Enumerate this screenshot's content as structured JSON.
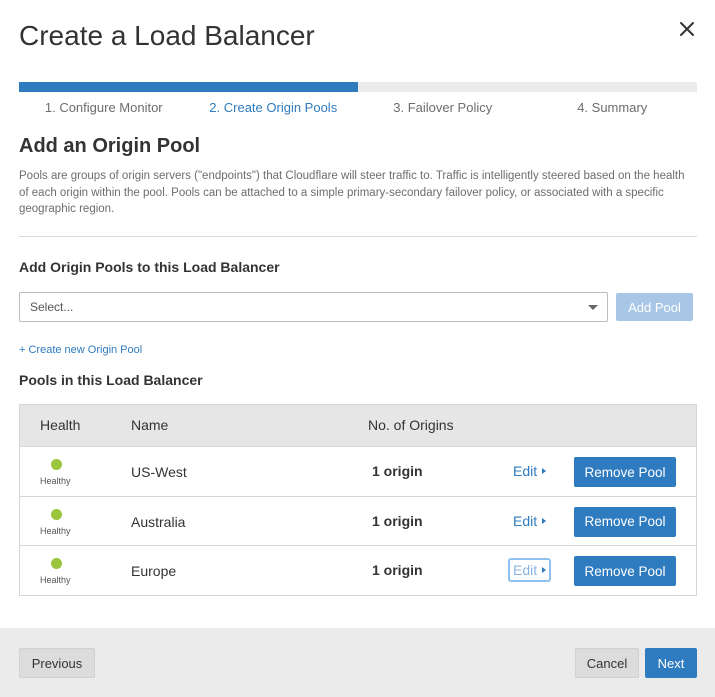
{
  "modal": {
    "title": "Create a Load Balancer"
  },
  "wizard": {
    "progress_fraction": 0.5,
    "steps": [
      {
        "label": "1. Configure Monitor"
      },
      {
        "label": "2. Create Origin Pools"
      },
      {
        "label": "3. Failover Policy"
      },
      {
        "label": "4. Summary"
      }
    ],
    "active_step": 2
  },
  "section": {
    "title": "Add an Origin Pool",
    "description": "Pools are groups of origin servers (\"endpoints\") that Cloudflare will steer traffic to. Traffic is intelligently steered based on the health of each origin within the pool. Pools can be attached to a simple primary-secondary failover policy, or associated with a specific geographic region."
  },
  "add_pools": {
    "heading": "Add Origin Pools to this Load Balancer",
    "select_value": "Select...",
    "add_button": "Add Pool",
    "create_link": "+ Create new Origin Pool"
  },
  "pools": {
    "heading": "Pools in this Load Balancer",
    "columns": {
      "health": "Health",
      "name": "Name",
      "origins": "No. of Origins"
    },
    "rows": [
      {
        "health": "Healthy",
        "name": "US-West",
        "origins": "1 origin",
        "edit": "Edit",
        "remove": "Remove Pool"
      },
      {
        "health": "Healthy",
        "name": "Australia",
        "origins": "1 origin",
        "edit": "Edit",
        "remove": "Remove Pool"
      },
      {
        "health": "Healthy",
        "name": "Europe",
        "origins": "1 origin",
        "edit": "Edit",
        "remove": "Remove Pool"
      }
    ],
    "health_color": "#9bc53d"
  },
  "footer": {
    "previous": "Previous",
    "cancel": "Cancel",
    "next": "Next"
  },
  "colors": {
    "accent": "#2f7bbf",
    "disabled_accent": "#a8c7e6"
  }
}
